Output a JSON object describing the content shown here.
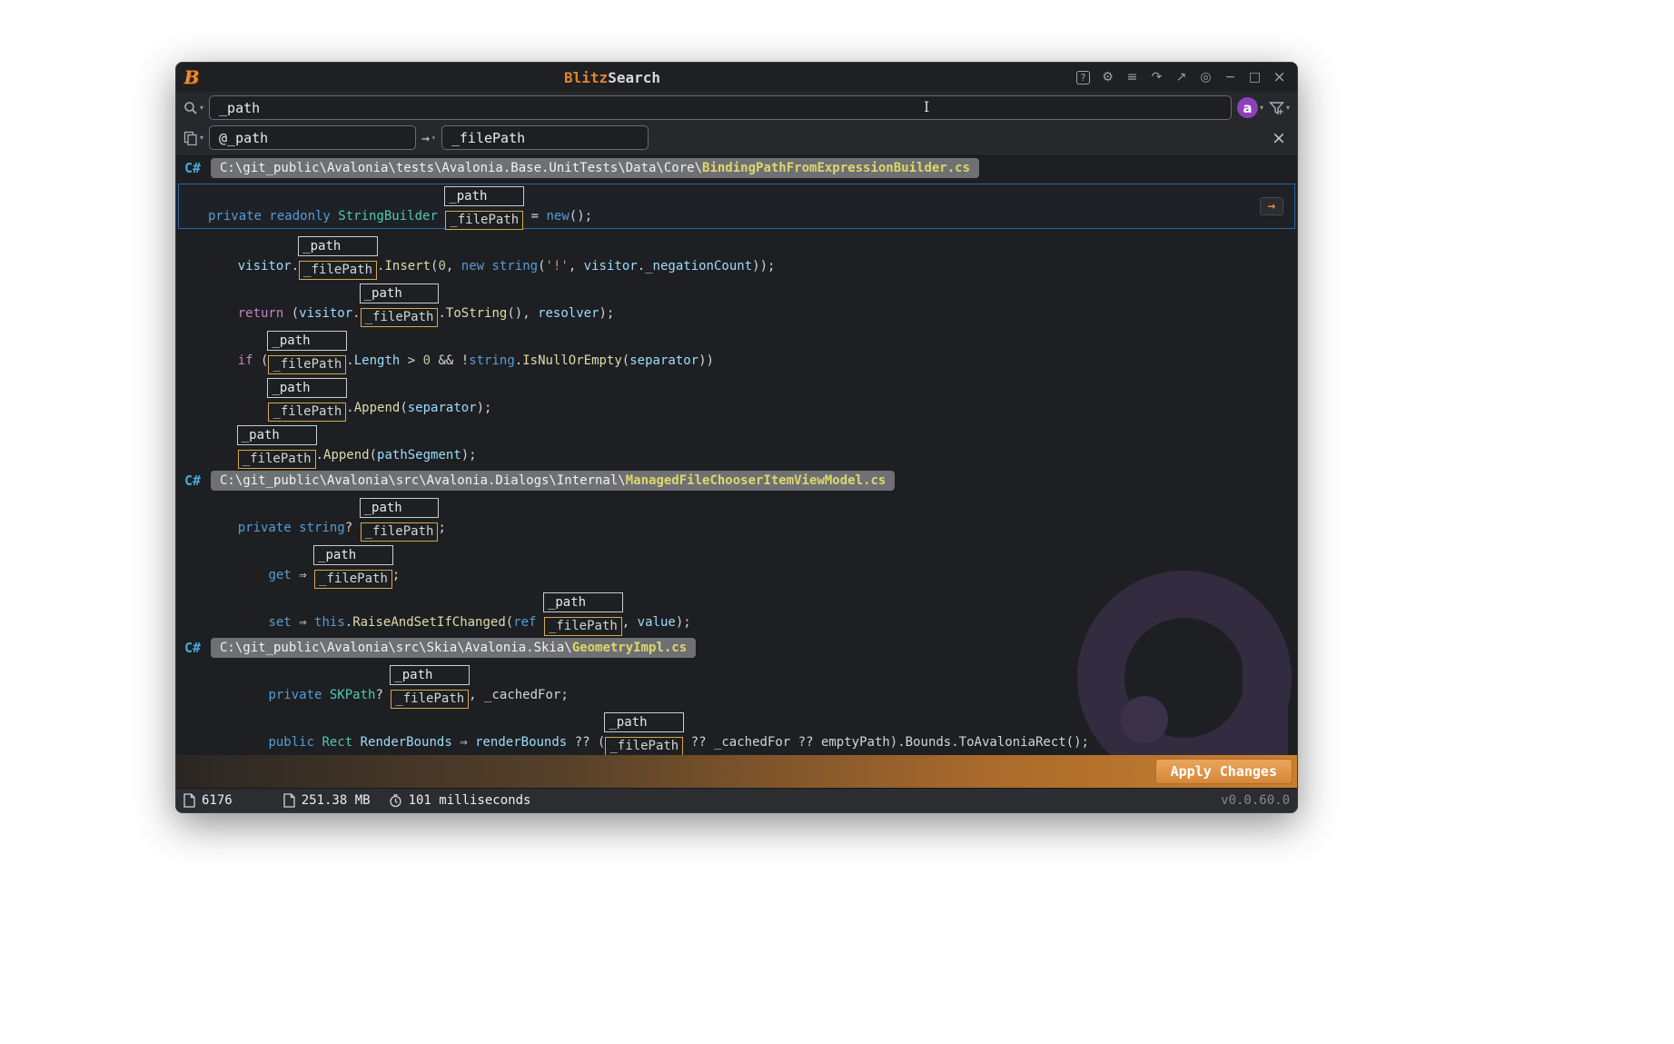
{
  "window": {
    "logo": "B",
    "title_accent": "Blitz",
    "title_rest": "Search",
    "version": "v0.0.60.0"
  },
  "titlebar": {
    "help": "?",
    "settings": "⚙",
    "menu": "≡",
    "redo": "↷",
    "pin": "↗",
    "globe": "◎",
    "minimize": "−",
    "maximize": "□",
    "close": "×"
  },
  "search": {
    "query": "_path",
    "dropdown": "▾",
    "scope_letter": "a",
    "replace_from": "@_path",
    "replace_to": "_filePath",
    "arrow": "→",
    "close": "×",
    "cursor": "I"
  },
  "match": {
    "find": "_path",
    "replace": "_filePath"
  },
  "results": {
    "csharp_icon": "C#",
    "goto_arrow": "→",
    "files": [
      {
        "dir": "C:\\git_public\\Avalonia\\tests\\Avalonia.Base.UnitTests\\Data\\Core\\",
        "name": "BindingPathFromExpressionBuilder.cs",
        "lines": [
          {
            "selected": true,
            "indent": 0,
            "tokens": [
              {
                "c": "k",
                "t": "private readonly "
              },
              {
                "c": "t",
                "t": "StringBuilder "
              },
              {
                "match": true
              },
              {
                "c": "p",
                "t": " = "
              },
              {
                "c": "k",
                "t": "new"
              },
              {
                "c": "p",
                "t": "();"
              }
            ]
          },
          {
            "indent": 4,
            "tokens": [
              {
                "c": "v",
                "t": "visitor"
              },
              {
                "c": "p",
                "t": "."
              },
              {
                "match": true
              },
              {
                "c": "p",
                "t": "."
              },
              {
                "c": "m",
                "t": "Insert"
              },
              {
                "c": "p",
                "t": "("
              },
              {
                "c": "n",
                "t": "0"
              },
              {
                "c": "p",
                "t": ", "
              },
              {
                "c": "k",
                "t": "new "
              },
              {
                "c": "k",
                "t": "string"
              },
              {
                "c": "p",
                "t": "("
              },
              {
                "c": "s",
                "t": "'!'"
              },
              {
                "c": "p",
                "t": ", "
              },
              {
                "c": "v",
                "t": "visitor"
              },
              {
                "c": "p",
                "t": "."
              },
              {
                "c": "v",
                "t": "_negationCount"
              },
              {
                "c": "p",
                "t": "));"
              }
            ]
          },
          {
            "indent": 4,
            "tokens": [
              {
                "c": "c",
                "t": "return"
              },
              {
                "c": "p",
                "t": " ("
              },
              {
                "c": "v",
                "t": "visitor"
              },
              {
                "c": "p",
                "t": "."
              },
              {
                "match": true
              },
              {
                "c": "p",
                "t": "."
              },
              {
                "c": "m",
                "t": "ToString"
              },
              {
                "c": "p",
                "t": "(), "
              },
              {
                "c": "v",
                "t": "resolver"
              },
              {
                "c": "p",
                "t": ");"
              }
            ]
          },
          {
            "indent": 4,
            "tokens": [
              {
                "c": "c",
                "t": "if"
              },
              {
                "c": "p",
                "t": " ("
              },
              {
                "match": true
              },
              {
                "c": "p",
                "t": "."
              },
              {
                "c": "v",
                "t": "Length"
              },
              {
                "c": "p",
                "t": " > "
              },
              {
                "c": "n",
                "t": "0"
              },
              {
                "c": "p",
                "t": " && !"
              },
              {
                "c": "k",
                "t": "string"
              },
              {
                "c": "p",
                "t": "."
              },
              {
                "c": "m",
                "t": "IsNullOrEmpty"
              },
              {
                "c": "p",
                "t": "("
              },
              {
                "c": "v",
                "t": "separator"
              },
              {
                "c": "p",
                "t": "))"
              }
            ]
          },
          {
            "indent": 8,
            "tokens": [
              {
                "match": true
              },
              {
                "c": "p",
                "t": "."
              },
              {
                "c": "m",
                "t": "Append"
              },
              {
                "c": "p",
                "t": "("
              },
              {
                "c": "v",
                "t": "separator"
              },
              {
                "c": "p",
                "t": ");"
              }
            ]
          },
          {
            "indent": 4,
            "tokens": [
              {
                "match": true
              },
              {
                "c": "p",
                "t": "."
              },
              {
                "c": "m",
                "t": "Append"
              },
              {
                "c": "p",
                "t": "("
              },
              {
                "c": "v",
                "t": "pathSegment"
              },
              {
                "c": "p",
                "t": ");"
              }
            ]
          }
        ]
      },
      {
        "dir": "C:\\git_public\\Avalonia\\src\\Avalonia.Dialogs\\Internal\\",
        "name": "ManagedFileChooserItemViewModel.cs",
        "lines": [
          {
            "indent": 4,
            "tokens": [
              {
                "c": "k",
                "t": "private "
              },
              {
                "c": "k",
                "t": "string"
              },
              {
                "c": "p",
                "t": "? "
              },
              {
                "match": true
              },
              {
                "c": "p",
                "t": ";"
              }
            ]
          },
          {
            "indent": 8,
            "tokens": [
              {
                "c": "k",
                "t": "get"
              },
              {
                "c": "p",
                "t": " ⇒ "
              },
              {
                "match": true
              },
              {
                "c": "p",
                "t": ";"
              }
            ]
          },
          {
            "indent": 8,
            "tokens": [
              {
                "c": "k",
                "t": "set"
              },
              {
                "c": "p",
                "t": " ⇒ "
              },
              {
                "c": "k",
                "t": "this"
              },
              {
                "c": "p",
                "t": "."
              },
              {
                "c": "m",
                "t": "RaiseAndSetIfChanged"
              },
              {
                "c": "p",
                "t": "("
              },
              {
                "c": "k",
                "t": "ref"
              },
              {
                "c": "p",
                "t": " "
              },
              {
                "match": true
              },
              {
                "c": "p",
                "t": ", "
              },
              {
                "c": "v",
                "t": "value"
              },
              {
                "c": "p",
                "t": ");"
              }
            ]
          }
        ]
      },
      {
        "dir": "C:\\git_public\\Avalonia\\src\\Skia\\Avalonia.Skia\\",
        "name": "GeometryImpl.cs",
        "lines": [
          {
            "indent": 8,
            "tokens": [
              {
                "c": "k",
                "t": "private "
              },
              {
                "c": "t",
                "t": "SKPath"
              },
              {
                "c": "p",
                "t": "? "
              },
              {
                "match": true
              },
              {
                "c": "p",
                "t": ", "
              },
              {
                "c": "p",
                "t": "_cachedFor"
              },
              {
                "c": "p",
                "t": ";"
              }
            ]
          },
          {
            "indent": 8,
            "tokens": [
              {
                "c": "k",
                "t": "public "
              },
              {
                "c": "t",
                "t": "Rect"
              },
              {
                "c": "p",
                "t": " "
              },
              {
                "c": "v",
                "t": "RenderBounds"
              },
              {
                "c": "p",
                "t": " ⇒ "
              },
              {
                "c": "v",
                "t": "renderBounds"
              },
              {
                "c": "p",
                "t": " ?? ("
              },
              {
                "match": true
              },
              {
                "c": "p",
                "t": " ?? _cachedFor ?? emptyPath).Bounds.ToAvaloniaRect();"
              }
            ]
          }
        ]
      }
    ]
  },
  "apply": {
    "label": "Apply Changes"
  },
  "status": {
    "count": "6176",
    "size": "251.38 MB",
    "time": "101 milliseconds"
  }
}
